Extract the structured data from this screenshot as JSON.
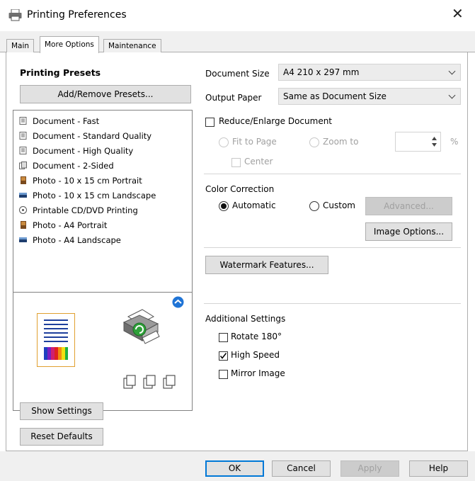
{
  "window": {
    "title": "Printing Preferences",
    "close_icon": "close-icon"
  },
  "tabs": [
    {
      "label": "Main",
      "active": false
    },
    {
      "label": "More Options",
      "active": true
    },
    {
      "label": "Maintenance",
      "active": false
    }
  ],
  "presets": {
    "heading": "Printing Presets",
    "add_remove_label": "Add/Remove Presets...",
    "items": [
      {
        "label": "Document - Fast",
        "icon": "document-icon"
      },
      {
        "label": "Document - Standard Quality",
        "icon": "document-icon"
      },
      {
        "label": "Document - High Quality",
        "icon": "document-icon"
      },
      {
        "label": "Document - 2-Sided",
        "icon": "two-sided-icon"
      },
      {
        "label": "Photo - 10 x 15 cm Portrait",
        "icon": "photo-portrait-icon"
      },
      {
        "label": "Photo - 10 x 15 cm Landscape",
        "icon": "photo-landscape-icon"
      },
      {
        "label": "Printable CD/DVD Printing",
        "icon": "disc-icon"
      },
      {
        "label": "Photo - A4 Portrait",
        "icon": "photo-portrait-icon"
      },
      {
        "label": "Photo - A4 Landscape",
        "icon": "photo-landscape-icon"
      }
    ]
  },
  "left_buttons": {
    "show_settings": "Show Settings",
    "reset_defaults": "Reset Defaults"
  },
  "document_size": {
    "label": "Document Size",
    "value": "A4 210 x 297 mm"
  },
  "output_paper": {
    "label": "Output Paper",
    "value": "Same as Document Size"
  },
  "reduce_enlarge": {
    "label": "Reduce/Enlarge Document",
    "checked": false,
    "fit_to_page": "Fit to Page",
    "zoom_to": "Zoom to",
    "zoom_value": "",
    "percent": "%",
    "center": "Center"
  },
  "color_correction": {
    "heading": "Color Correction",
    "automatic": "Automatic",
    "custom": "Custom",
    "selected": "Automatic",
    "advanced": "Advanced...",
    "image_options": "Image Options..."
  },
  "watermark": {
    "label": "Watermark Features..."
  },
  "additional_settings": {
    "heading": "Additional Settings",
    "rotate": {
      "label": "Rotate 180°",
      "checked": false
    },
    "high_speed": {
      "label": "High Speed",
      "checked": true
    },
    "mirror": {
      "label": "Mirror Image",
      "checked": false
    }
  },
  "footer": {
    "ok": "OK",
    "cancel": "Cancel",
    "apply": "Apply",
    "help": "Help"
  },
  "colors": {
    "accent": "#0078d7",
    "face": "#f0f0f0",
    "disabled_text": "#a0a0a0"
  }
}
